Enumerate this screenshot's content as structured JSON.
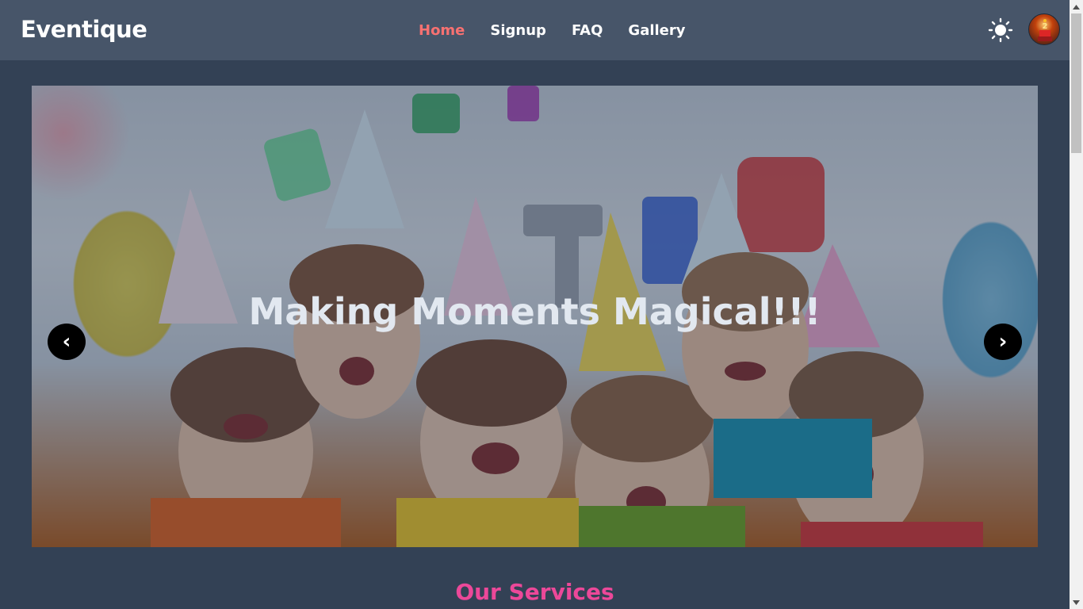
{
  "header": {
    "brand": "Eventique",
    "nav": [
      {
        "label": "Home",
        "active": true
      },
      {
        "label": "Signup",
        "active": false
      },
      {
        "label": "FAQ",
        "active": false
      },
      {
        "label": "Gallery",
        "active": false
      }
    ],
    "theme_icon": "sun-icon",
    "avatar_icon": "user-avatar"
  },
  "hero": {
    "title": "Making Moments Magical!!!",
    "prev_label": "‹",
    "next_label": "›"
  },
  "services": {
    "title": "Our Services"
  },
  "colors": {
    "navbar_bg": "#475569",
    "page_bg": "#334155",
    "active_link": "#f87171",
    "section_title": "#ec4899"
  }
}
